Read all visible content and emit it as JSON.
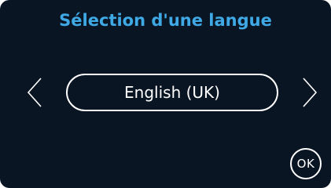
{
  "screen": {
    "title": "Sélection d'une langue",
    "selected_language": "English (UK)",
    "ok_label": "OK"
  },
  "icons": {
    "previous": "chevron-left-icon",
    "next": "chevron-right-icon"
  },
  "colors": {
    "background": "#0a1524",
    "title": "#3fa9e6",
    "foreground": "#ffffff"
  }
}
